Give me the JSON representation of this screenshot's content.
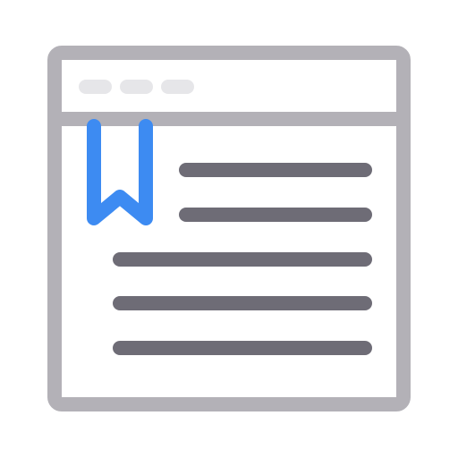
{
  "icon": {
    "name": "bookmarked-webpage-icon"
  },
  "colors": {
    "frame": "#b3b1b7",
    "dots": "#e6e6e9",
    "text_lines": "#6e6c76",
    "bookmark": "#3d8bf2",
    "background": "#ffffff"
  }
}
